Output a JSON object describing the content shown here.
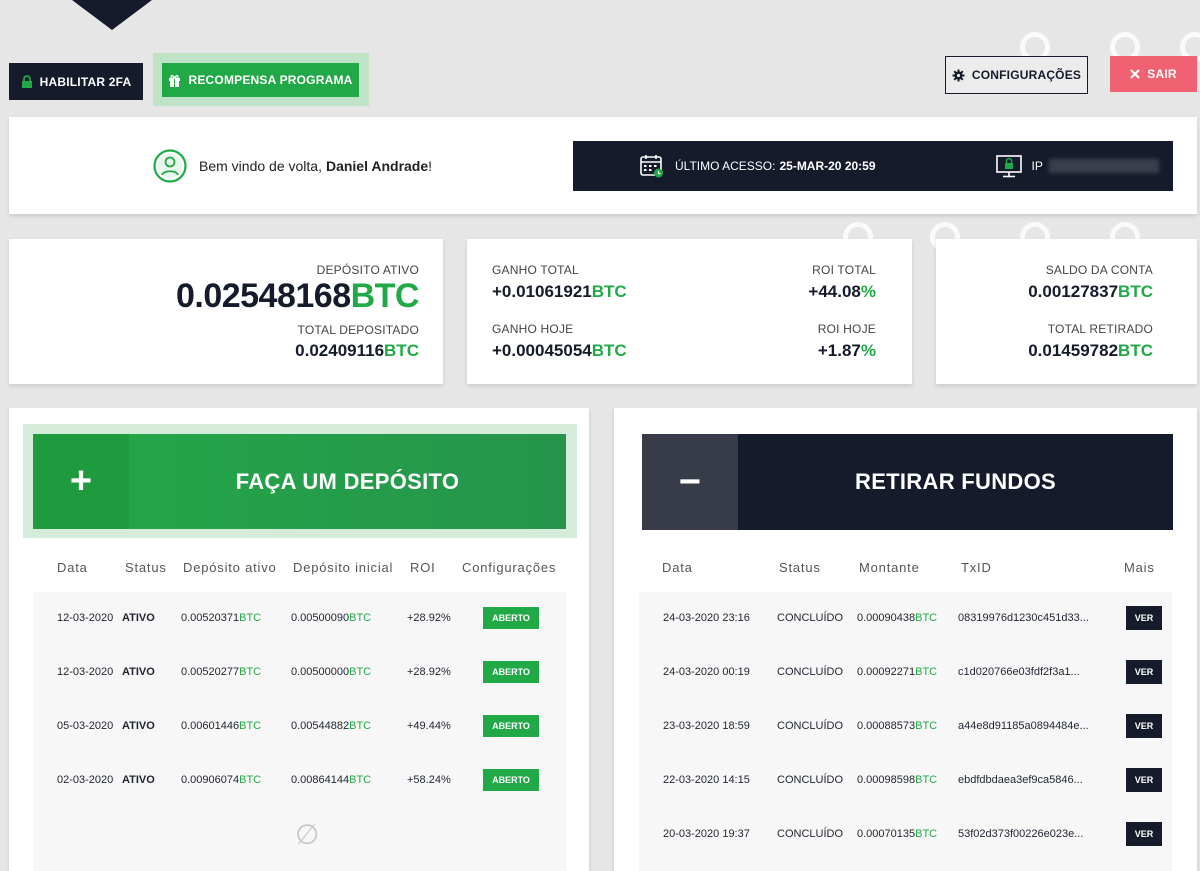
{
  "top_buttons": {
    "enable_2fa": "HABILITAR 2FA",
    "reward_program": "RECOMPENSA PROGRAMA",
    "settings": "CONFIGURAÇÕES",
    "exit": "SAIR"
  },
  "welcome": {
    "prefix": "Bem vindo de volta,",
    "user": "Daniel Andrade",
    "suffix": "!"
  },
  "access": {
    "last_access_label": "ÚLTIMO ACESSO:",
    "last_access_value": "25-MAR-20 20:59",
    "ip_label": "IP"
  },
  "deposit_card": {
    "active_label": "DEPÓSITO ATIVO",
    "active_value": "0.02548168",
    "total_label": "TOTAL DEPOSITADO",
    "total_value": "0.02409116",
    "unit": "BTC"
  },
  "gain_card": {
    "total_gain_label": "GANHO TOTAL",
    "total_gain_value": "+0.01061921",
    "today_gain_label": "GANHO HOJE",
    "today_gain_value": "+0.00045054",
    "roi_total_label": "ROI TOTAL",
    "roi_total_value": "+44.08",
    "roi_today_label": "ROI HOJE",
    "roi_today_value": "+1.87",
    "unit": "BTC",
    "pct": "%"
  },
  "balance_card": {
    "balance_label": "SALDO DA CONTA",
    "balance_value": "0.00127837",
    "withdrawn_label": "TOTAL RETIRADO",
    "withdrawn_value": "0.01459782",
    "unit": "BTC"
  },
  "deposit_panel": {
    "symbol": "+",
    "title": "FAÇA UM DEPÓSITO",
    "headers": [
      "Data",
      "Status",
      "Depósito ativo",
      "Depósito inicial",
      "ROI",
      "Configurações"
    ],
    "rows": [
      {
        "date": "12-03-2020",
        "status": "ATIVO",
        "active": "0.00520371",
        "initial": "0.00500090",
        "roi": "+28.92%",
        "action": "ABERTO"
      },
      {
        "date": "12-03-2020",
        "status": "ATIVO",
        "active": "0.00520277",
        "initial": "0.00500000",
        "roi": "+28.92%",
        "action": "ABERTO"
      },
      {
        "date": "05-03-2020",
        "status": "ATIVO",
        "active": "0.00601446",
        "initial": "0.00544882",
        "roi": "+49.44%",
        "action": "ABERTO"
      },
      {
        "date": "02-03-2020",
        "status": "ATIVO",
        "active": "0.00906074",
        "initial": "0.00864144",
        "roi": "+58.24%",
        "action": "ABERTO"
      }
    ],
    "unit": "BTC",
    "empty_symbol": "∅"
  },
  "withdraw_panel": {
    "symbol": "−",
    "title": "RETIRAR FUNDOS",
    "headers": [
      "Data",
      "Status",
      "Montante",
      "TxID",
      "Mais"
    ],
    "rows": [
      {
        "date": "24-03-2020 23:16",
        "status": "CONCLUÍDO",
        "amount": "0.00090438",
        "txid": "08319976d1230c451d33...",
        "action": "VER"
      },
      {
        "date": "24-03-2020 00:19",
        "status": "CONCLUÍDO",
        "amount": "0.00092271",
        "txid": "c1d020766e03fdf2f3a1...",
        "action": "VER"
      },
      {
        "date": "23-03-2020 18:59",
        "status": "CONCLUÍDO",
        "amount": "0.00088573",
        "txid": "a44e8d91185a0894484e...",
        "action": "VER"
      },
      {
        "date": "22-03-2020 14:15",
        "status": "CONCLUÍDO",
        "amount": "0.00098598",
        "txid": "ebdfdbdaea3ef9ca5846...",
        "action": "VER"
      },
      {
        "date": "20-03-2020 19:37",
        "status": "CONCLUÍDO",
        "amount": "0.00070135",
        "txid": "53f02d373f00226e023e...",
        "action": "VER"
      }
    ],
    "unit": "BTC"
  },
  "colors": {
    "accent_green": "#22a947",
    "dark": "#161b2b",
    "danger": "#f06272"
  }
}
